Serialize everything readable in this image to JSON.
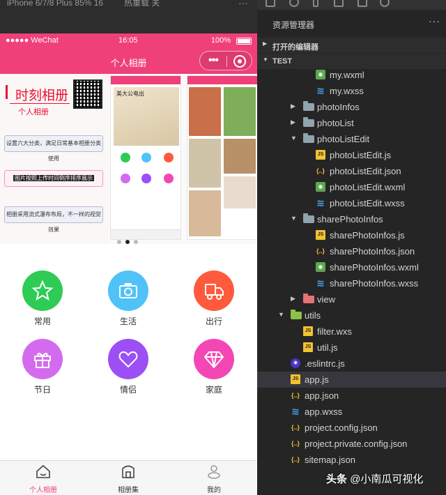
{
  "devtools": {
    "device_label": "iPhone 6/7/8 Plus 85% 16",
    "reload_label": "热重载 关",
    "more": "···"
  },
  "status_bar": {
    "carrier": "●●●●● WeChat",
    "time": "16:05",
    "battery": "100%"
  },
  "nav": {
    "title": "个人相册"
  },
  "banner": {
    "title": "时刻相册",
    "subtitle": "个人相册",
    "features": [
      "设置六大分类，满足日常基本相册分类使用",
      "图片按照上传时间倒序排序展示",
      "相册采用流式瀑布布局，不一样的视觉效果"
    ],
    "mock_art_text": "美大公电出"
  },
  "categories": [
    {
      "label": "常用",
      "icon": "star-icon",
      "color": "#2ecc55"
    },
    {
      "label": "生活",
      "icon": "camera-icon",
      "color": "#4fc3f7"
    },
    {
      "label": "出行",
      "icon": "truck-icon",
      "color": "#ff5a3c"
    },
    {
      "label": "节日",
      "icon": "gift-icon",
      "color": "#d46bef"
    },
    {
      "label": "情侣",
      "icon": "heart-icon",
      "color": "#9c4ff5"
    },
    {
      "label": "家庭",
      "icon": "diamond-icon",
      "color": "#f447b5"
    }
  ],
  "tabbar": [
    {
      "label": "个人相册",
      "icon": "home-icon",
      "active": true
    },
    {
      "label": "相册集",
      "icon": "album-icon",
      "active": false
    },
    {
      "label": "我的",
      "icon": "user-icon",
      "active": false
    }
  ],
  "explorer": {
    "title": "资源管理器",
    "more": "···",
    "open_editors": "打开的编辑器",
    "project": "TEST",
    "tree": [
      {
        "name": "my.wxml",
        "type": "wxml",
        "depth": 2
      },
      {
        "name": "my.wxss",
        "type": "wxss",
        "depth": 2
      },
      {
        "name": "photoInfos",
        "type": "folder",
        "depth": 1,
        "collapsed": true
      },
      {
        "name": "photoList",
        "type": "folder",
        "depth": 1,
        "collapsed": true
      },
      {
        "name": "photoListEdit",
        "type": "folder",
        "depth": 1,
        "collapsed": false
      },
      {
        "name": "photoListEdit.js",
        "type": "js",
        "depth": 2
      },
      {
        "name": "photoListEdit.json",
        "type": "json",
        "depth": 2
      },
      {
        "name": "photoListEdit.wxml",
        "type": "wxml",
        "depth": 2
      },
      {
        "name": "photoListEdit.wxss",
        "type": "wxss",
        "depth": 2
      },
      {
        "name": "sharePhotoInfos",
        "type": "folder",
        "depth": 1,
        "collapsed": false
      },
      {
        "name": "sharePhotoInfos.js",
        "type": "js",
        "depth": 2
      },
      {
        "name": "sharePhotoInfos.json",
        "type": "json",
        "depth": 2
      },
      {
        "name": "sharePhotoInfos.wxml",
        "type": "wxml",
        "depth": 2
      },
      {
        "name": "sharePhotoInfos.wxss",
        "type": "wxss",
        "depth": 2
      },
      {
        "name": "view",
        "type": "folder-red",
        "depth": 1,
        "collapsed": true
      },
      {
        "name": "utils",
        "type": "folder-green",
        "depth": 0,
        "collapsed": false
      },
      {
        "name": "filter.wxs",
        "type": "js",
        "depth": 1
      },
      {
        "name": "util.js",
        "type": "js",
        "depth": 1
      },
      {
        "name": ".eslintrc.js",
        "type": "eslint",
        "depth": 0
      },
      {
        "name": "app.js",
        "type": "js",
        "depth": 0,
        "selected": true
      },
      {
        "name": "app.json",
        "type": "json",
        "depth": 0
      },
      {
        "name": "app.wxss",
        "type": "wxss",
        "depth": 0
      },
      {
        "name": "project.config.json",
        "type": "json",
        "depth": 0
      },
      {
        "name": "project.private.config.json",
        "type": "json",
        "depth": 0
      },
      {
        "name": "sitemap.json",
        "type": "json",
        "depth": 0
      }
    ]
  },
  "watermark": {
    "brand": "头条",
    "author": "@小南瓜可视化"
  },
  "colors": {
    "accent": "#f0407a",
    "explorer_bg": "#252526",
    "selection": "#37373d"
  }
}
